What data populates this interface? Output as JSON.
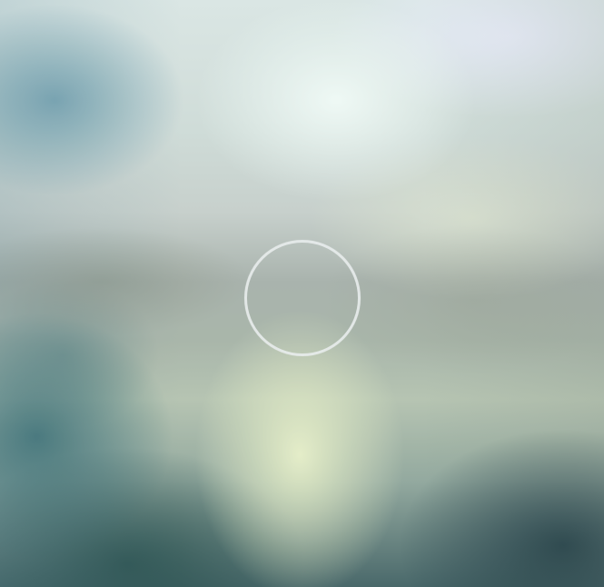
{
  "screen": {
    "background_description_colors": {
      "top_highlight": "#f0faf6",
      "upper_right_tint": "#e8ecfa",
      "left_blue": "#6096aa",
      "center_glow": "#e8f0c8",
      "lower_left_teal": "#28646e",
      "lower_right_dark": "#1e3c46"
    },
    "loader": {
      "icon": "loading-ring-icon",
      "ring_color": "#e8ecec"
    }
  }
}
